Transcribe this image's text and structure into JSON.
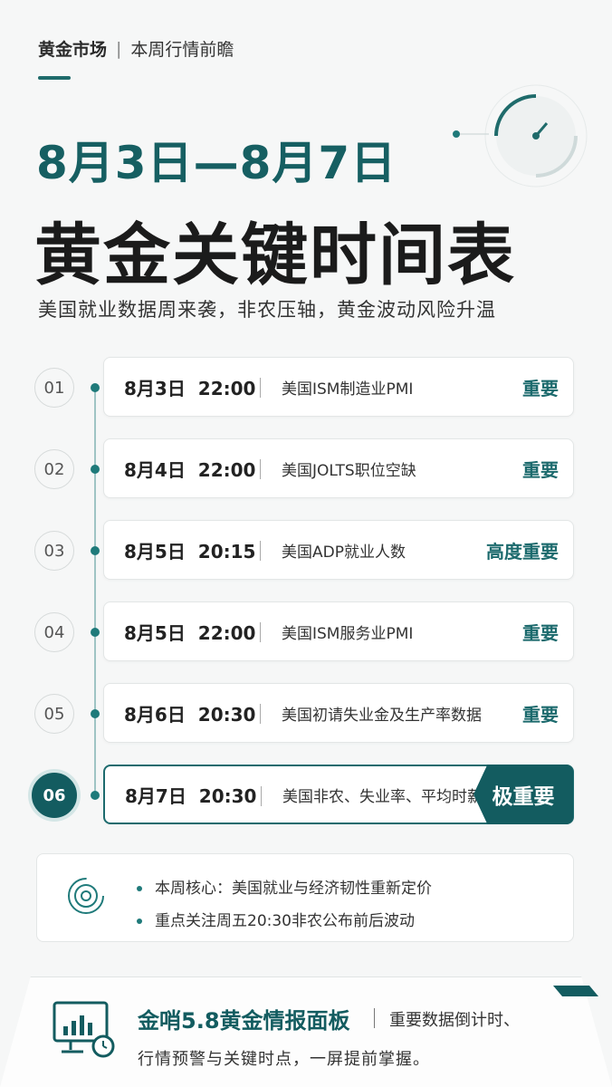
{
  "header": {
    "category": "黄金市场",
    "separator": "|",
    "section": "本周行情前瞻"
  },
  "hero": {
    "date_range": "8月3日—8月7日",
    "title": "黄金关键时间表",
    "subtitle": "美国就业数据周来袭，非农压轴，黄金波动风险升温"
  },
  "events": [
    {
      "num": "01",
      "date": "8月3日",
      "time": "22:00",
      "event": "美国ISM制造业PMI",
      "level": "重要"
    },
    {
      "num": "02",
      "date": "8月4日",
      "time": "22:00",
      "event": "美国JOLTS职位空缺",
      "level": "重要"
    },
    {
      "num": "03",
      "date": "8月5日",
      "time": "20:15",
      "event": "美国ADP就业人数",
      "level": "高度重要"
    },
    {
      "num": "04",
      "date": "8月5日",
      "time": "22:00",
      "event": "美国ISM服务业PMI",
      "level": "重要"
    },
    {
      "num": "05",
      "date": "8月6日",
      "time": "20:30",
      "event": "美国初请失业金及生产率数据",
      "level": "重要"
    },
    {
      "num": "06",
      "date": "8月7日",
      "time": "20:30",
      "event": "美国非农、失业率、平均时薪",
      "level": "极重要",
      "active": true
    }
  ],
  "summary": {
    "icon": "target-icon",
    "items": [
      "本周核心：美国就业与经济韧性重新定价",
      "重点关注周五20:30非农公布前后波动"
    ]
  },
  "footer": {
    "icon": "dashboard-clock-icon",
    "brand": "金哨5.8黄金情报面板",
    "desc_line1": "重要数据倒计时、",
    "desc_line2": "行情预警与关键时点，一屏提前掌握。"
  },
  "colors": {
    "accent": "#135c60",
    "accent_light": "#1f7a7a",
    "background": "#f6f7f7"
  }
}
